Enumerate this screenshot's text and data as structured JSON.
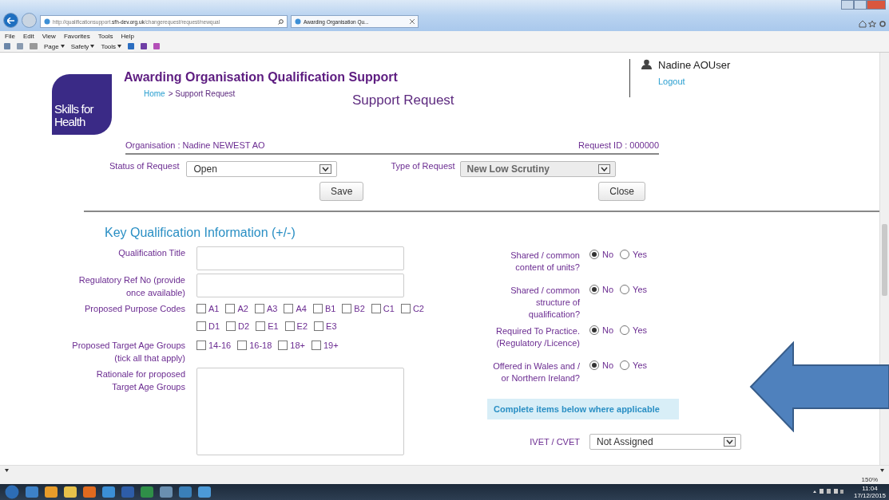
{
  "browser": {
    "address": "http://qualificationsupport.**sfh-dev.org.uk**/changerequest/request/newqual",
    "tab_title": "Awarding Organisation Qu...",
    "menu": [
      "File",
      "Edit",
      "View",
      "Favorites",
      "Tools",
      "Help"
    ],
    "commands": [
      "Page",
      "Safety",
      "Tools"
    ],
    "zoom": "150%"
  },
  "header": {
    "logo_lines": [
      "Skills for",
      "Health"
    ],
    "site_title": "Awarding Organisation Qualification Support",
    "breadcrumb_link": "Home",
    "breadcrumb_rest": "> Support Request",
    "page_heading": "Support Request",
    "user": "Nadine AOUser",
    "logout": "Logout"
  },
  "summary": {
    "organisation": "Organisation : Nadine NEWEST AO",
    "request_id": "Request ID : 000000"
  },
  "request_fields": [
    {
      "label": "Status of Request",
      "value": "Open",
      "disabled": false
    },
    {
      "label": "Type of Request",
      "value": "New Low Scrutiny",
      "disabled": true
    }
  ],
  "buttons": [
    "Save",
    "Close"
  ],
  "section_title": "Key Qualification Information (+/-)",
  "left_fields": [
    {
      "kind": "text",
      "label": [
        "Qualification Title"
      ]
    },
    {
      "kind": "text",
      "label": [
        "Regulatory Ref No (provide",
        "once available)"
      ]
    },
    {
      "kind": "checks",
      "label": [
        "Proposed Purpose Codes"
      ],
      "options": [
        {
          "label": "A1",
          "checked": false
        },
        {
          "label": "A2",
          "checked": false
        },
        {
          "label": "A3",
          "checked": false
        },
        {
          "label": "A4",
          "checked": false
        },
        {
          "label": "B1",
          "checked": false
        },
        {
          "label": "B2",
          "checked": false
        },
        {
          "label": "C1",
          "checked": false
        },
        {
          "label": "C2",
          "checked": false
        },
        {
          "label": "D1",
          "checked": false
        },
        {
          "label": "D2",
          "checked": false
        },
        {
          "label": "E1",
          "checked": false
        },
        {
          "label": "E2",
          "checked": false
        },
        {
          "label": "E3",
          "checked": false
        }
      ]
    },
    {
      "kind": "checks",
      "label": [
        "Proposed Target Age Groups",
        "(tick all that apply)"
      ],
      "options": [
        {
          "label": "14-16",
          "checked": false
        },
        {
          "label": "16-18",
          "checked": false
        },
        {
          "label": "18+",
          "checked": false
        },
        {
          "label": "19+",
          "checked": false
        }
      ]
    },
    {
      "kind": "area",
      "label": [
        "Rationale for proposed",
        "Target Age Groups"
      ]
    }
  ],
  "right_fields": [
    {
      "label": [
        "Shared / common",
        "content of units?"
      ],
      "options": [
        {
          "label": "No",
          "selected": true
        },
        {
          "label": "Yes",
          "selected": false
        }
      ]
    },
    {
      "label": [
        "Shared / common",
        "structure of",
        "qualification?"
      ],
      "options": [
        {
          "label": "No",
          "selected": true
        },
        {
          "label": "Yes",
          "selected": false
        }
      ]
    },
    {
      "label": [
        "Required To Practice.",
        "(Regulatory /Licence)"
      ],
      "options": [
        {
          "label": "No",
          "selected": true
        },
        {
          "label": "Yes",
          "selected": false
        }
      ]
    },
    {
      "label": [
        "Offered in Wales and /",
        "or Northern Ireland?"
      ],
      "options": [
        {
          "label": "No",
          "selected": true
        },
        {
          "label": "Yes",
          "selected": false
        }
      ]
    }
  ],
  "notice": "Complete items below where applicable",
  "ivet": {
    "label": "IVET / CVET",
    "value": "Not Assigned"
  },
  "taskbar": {
    "time": "11:04",
    "date": "17/12/2015"
  }
}
